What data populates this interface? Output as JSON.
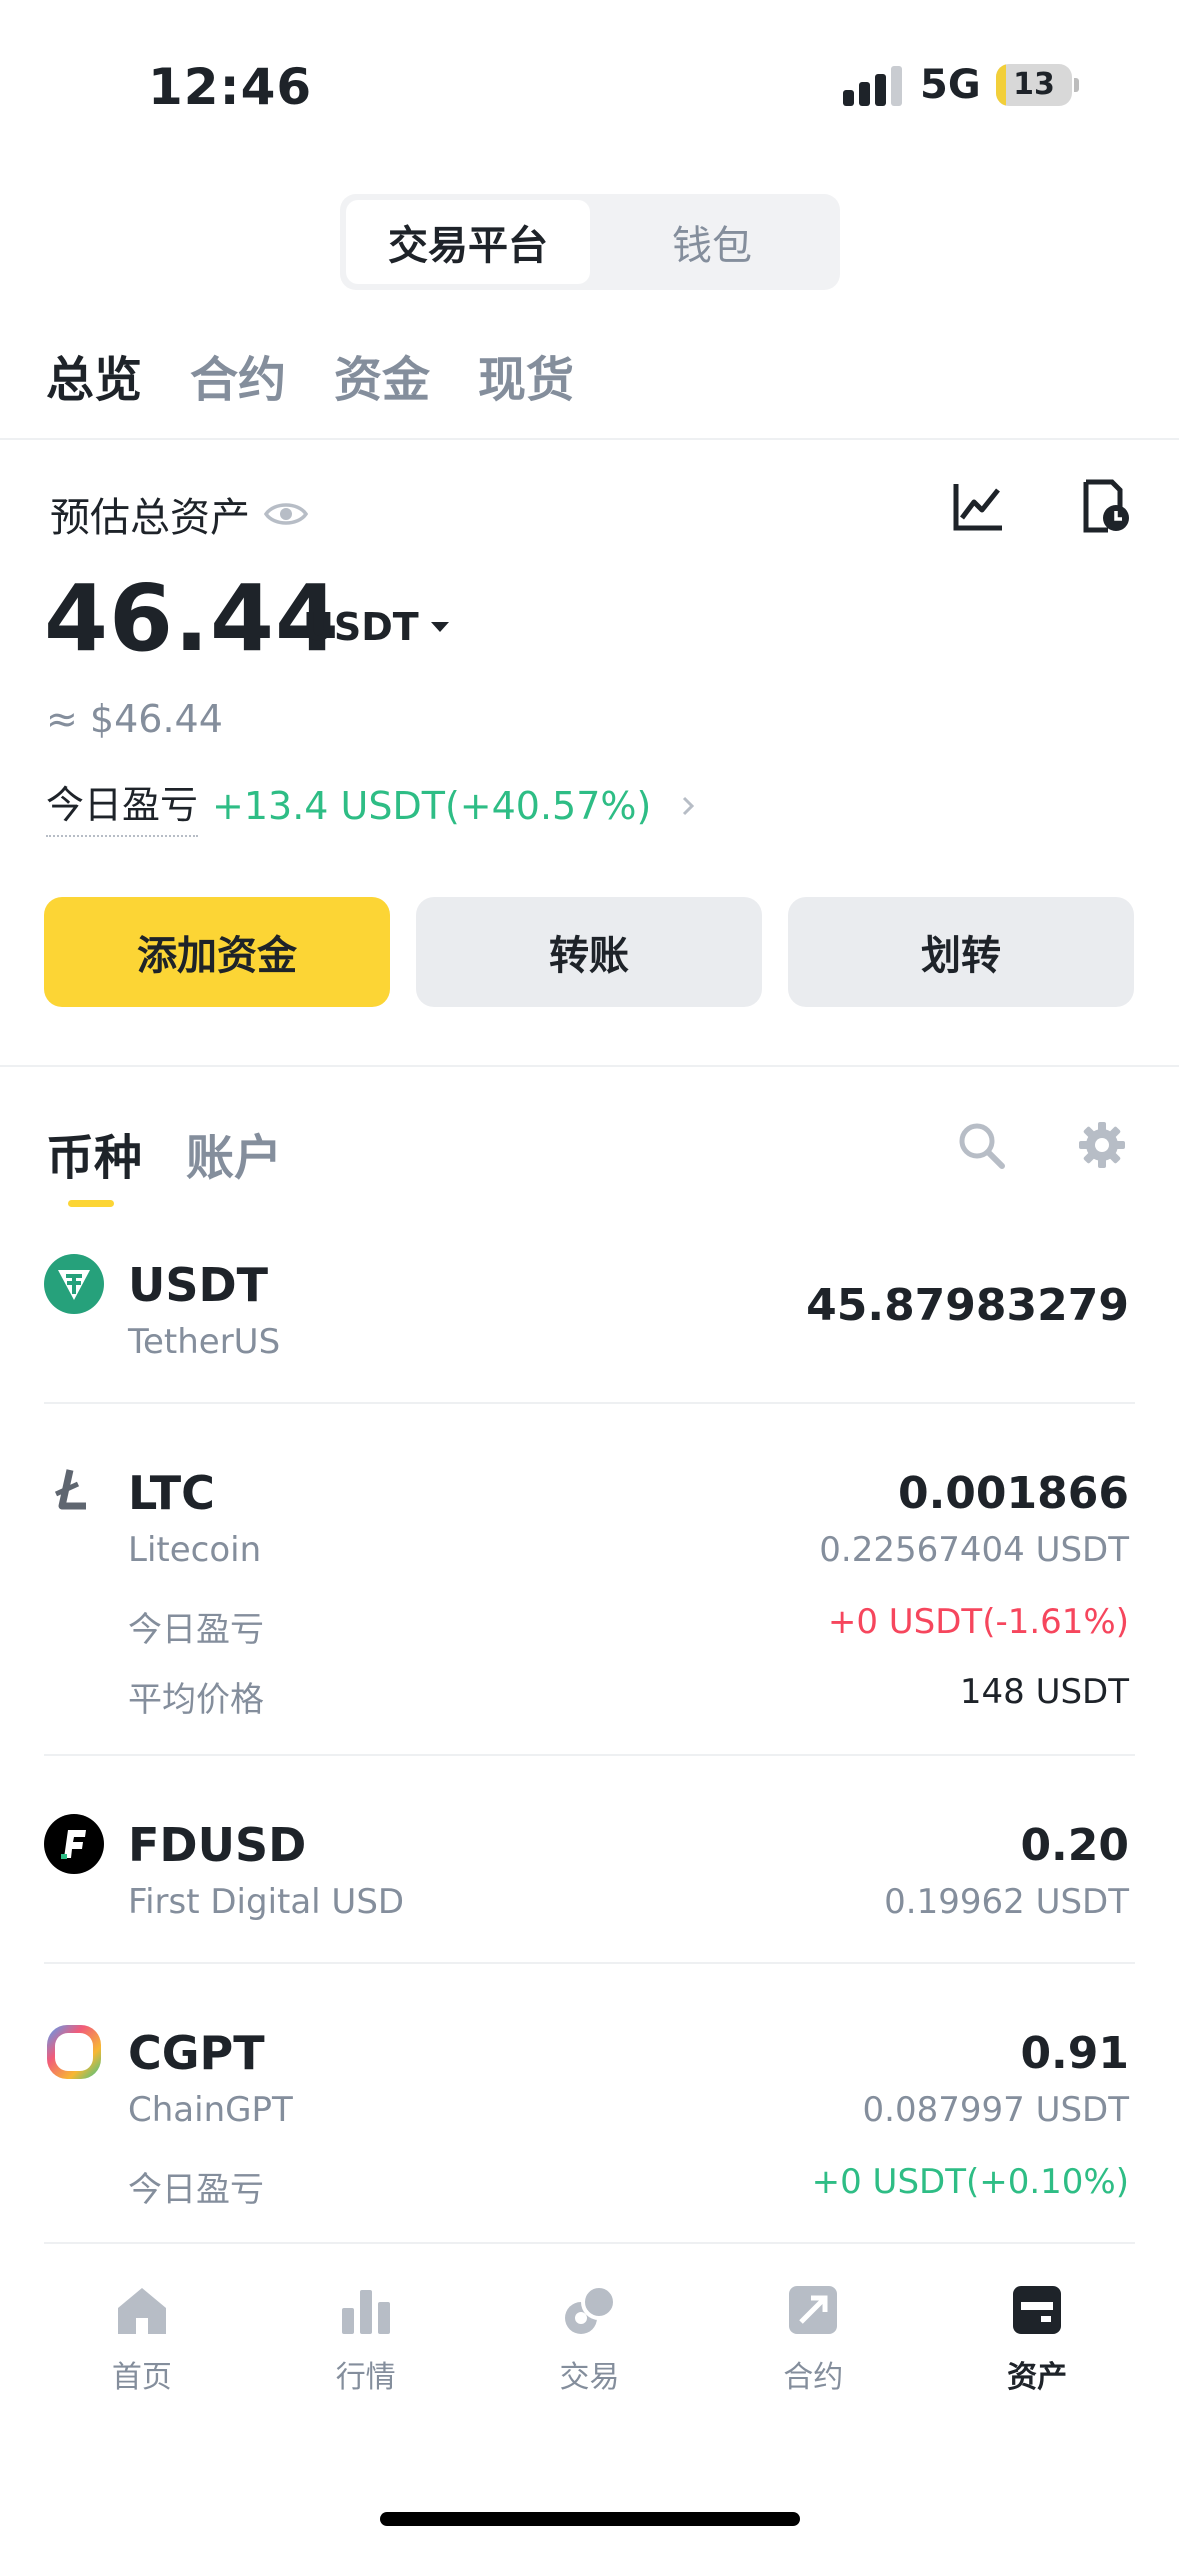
{
  "status_bar": {
    "time": "12:46",
    "network": "5G",
    "battery": "13",
    "battery_level": 0.13
  },
  "segmented": {
    "left": "交易平台",
    "right": "钱包"
  },
  "tabs": [
    "总览",
    "合约",
    "资金",
    "现货"
  ],
  "summary": {
    "label": "预估总资产",
    "balance": "46.44",
    "unit": "USDT",
    "approx": "≈ $46.44",
    "pnl_label": "今日盈亏",
    "pnl_value": "+13.4 USDT(+40.57%)"
  },
  "actions": {
    "add": "添加资金",
    "transfer": "转账",
    "move": "划转"
  },
  "list_tabs": [
    "币种",
    "账户"
  ],
  "coins": [
    {
      "symbol": "USDT",
      "name": "TetherUS",
      "amount": "45.87983279"
    },
    {
      "symbol": "LTC",
      "name": "Litecoin",
      "amount": "0.001866",
      "value": "0.22567404 USDT",
      "pnl_label": "今日盈亏",
      "pnl": "+0 USDT(-1.61%)",
      "avg_label": "平均价格",
      "avg": "148 USDT"
    },
    {
      "symbol": "FDUSD",
      "name": "First Digital USD",
      "amount": "0.20",
      "value": "0.19962 USDT"
    },
    {
      "symbol": "CGPT",
      "name": "ChainGPT",
      "amount": "0.91",
      "value": "0.087997 USDT",
      "pnl_label": "今日盈亏",
      "pnl": "+0 USDT(+0.10%)"
    }
  ],
  "nav": [
    {
      "label": "首页",
      "icon": "home-icon"
    },
    {
      "label": "行情",
      "icon": "markets-icon"
    },
    {
      "label": "交易",
      "icon": "trade-icon"
    },
    {
      "label": "合约",
      "icon": "futures-icon"
    },
    {
      "label": "资产",
      "icon": "wallet-icon",
      "active": true
    }
  ],
  "colors": {
    "accent": "#FCD535",
    "up": "#2EBD85",
    "down": "#F6465D",
    "text": "#1E2329",
    "muted": "#848E9C"
  }
}
